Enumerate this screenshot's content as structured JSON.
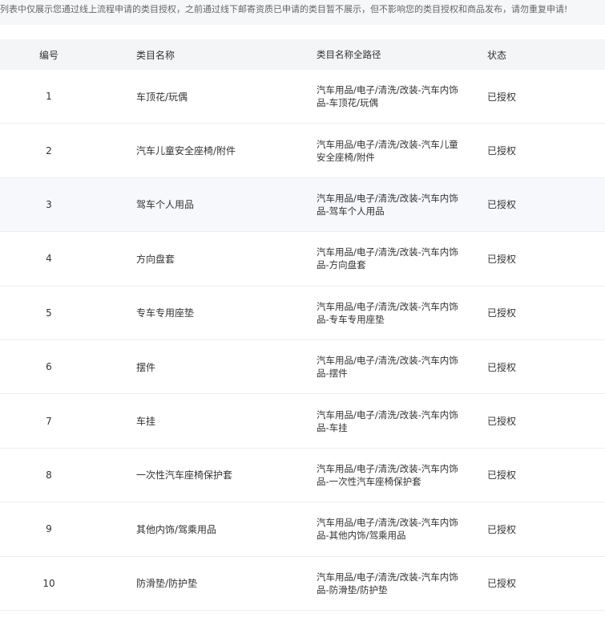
{
  "notice": "列表中仅展示您通过线上流程申请的类目授权，之前通过线下邮寄资质已申请的类目暂不展示，但不影响您的类目授权和商品发布，请勿重复申请!",
  "table": {
    "headers": {
      "num": "编号",
      "name": "类目名称",
      "path": "类目名称全路径",
      "status": "状态"
    },
    "rows": [
      {
        "num": "1",
        "name": "车顶花/玩偶",
        "path": "汽车用品/电子/清洗/改装-汽车内饰品-车顶花/玩偶",
        "status": "已授权"
      },
      {
        "num": "2",
        "name": "汽车儿童安全座椅/附件",
        "path": "汽车用品/电子/清洗/改装-汽车儿童安全座椅/附件",
        "status": "已授权"
      },
      {
        "num": "3",
        "name": "驾车个人用品",
        "path": "汽车用品/电子/清洗/改装-汽车内饰品-驾车个人用品",
        "status": "已授权"
      },
      {
        "num": "4",
        "name": "方向盘套",
        "path": "汽车用品/电子/清洗/改装-汽车内饰品-方向盘套",
        "status": "已授权"
      },
      {
        "num": "5",
        "name": "专车专用座垫",
        "path": "汽车用品/电子/清洗/改装-汽车内饰品-专车专用座垫",
        "status": "已授权"
      },
      {
        "num": "6",
        "name": "摆件",
        "path": "汽车用品/电子/清洗/改装-汽车内饰品-摆件",
        "status": "已授权"
      },
      {
        "num": "7",
        "name": "车挂",
        "path": "汽车用品/电子/清洗/改装-汽车内饰品-车挂",
        "status": "已授权"
      },
      {
        "num": "8",
        "name": "一次性汽车座椅保护套",
        "path": "汽车用品/电子/清洗/改装-汽车内饰品-一次性汽车座椅保护套",
        "status": "已授权"
      },
      {
        "num": "9",
        "name": "其他内饰/驾乘用品",
        "path": "汽车用品/电子/清洗/改装-汽车内饰品-其他内饰/驾乘用品",
        "status": "已授权"
      },
      {
        "num": "10",
        "name": "防滑垫/防护垫",
        "path": "汽车用品/电子/清洗/改装-汽车内饰品-防滑垫/防护垫",
        "status": "已授权"
      }
    ]
  }
}
